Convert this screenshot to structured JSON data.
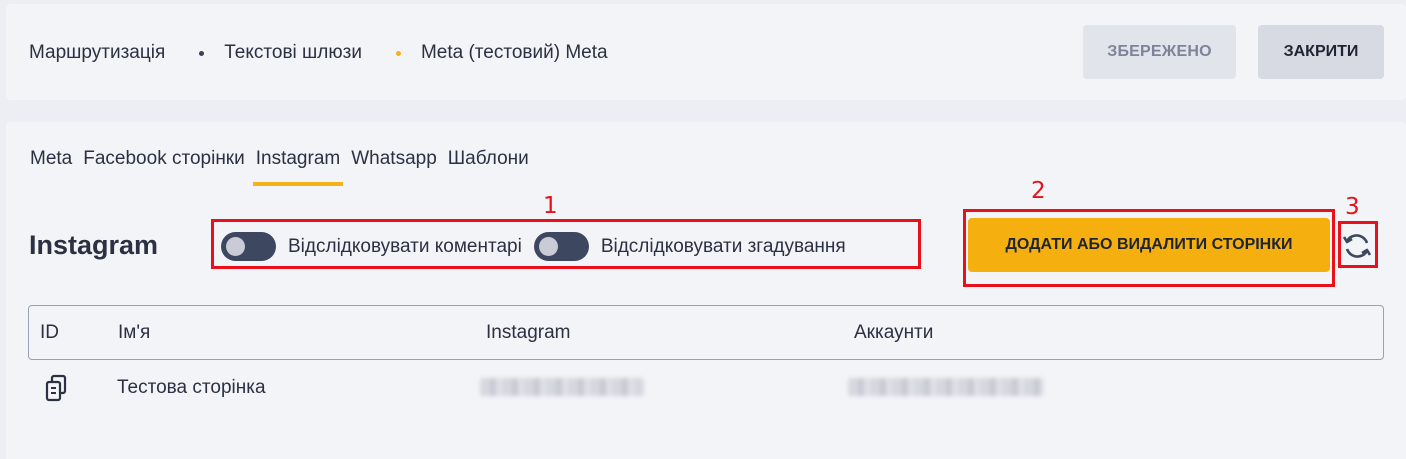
{
  "header": {
    "breadcrumb": [
      "Маршрутизація",
      "Текстові шлюзи",
      "Meta (тестовий) Meta"
    ],
    "saved_label": "ЗБЕРЕЖЕНО",
    "close_label": "ЗАКРИТИ"
  },
  "tabs": [
    "Meta",
    "Facebook сторінки",
    "Instagram",
    "Whatsapp",
    "Шаблони"
  ],
  "active_tab": "Instagram",
  "section": {
    "title": "Instagram",
    "toggle_comments": "Відслідковувати коментарі",
    "toggle_mentions": "Відслідковувати згадування",
    "add_button": "ДОДАТИ АБО ВИДАЛИТИ СТОРІНКИ"
  },
  "annotations": [
    "1",
    "2",
    "3"
  ],
  "table": {
    "columns": [
      "ID",
      "Ім'я",
      "Instagram",
      "Аккаунти"
    ],
    "rows": [
      {
        "name": "Тестова сторінка"
      }
    ]
  },
  "colors": {
    "accent": "#f5b00f",
    "annotation": "#e8101a",
    "toggle": "#3d4760"
  },
  "icons": {
    "copy": "copy-icon",
    "refresh": "refresh-icon"
  }
}
